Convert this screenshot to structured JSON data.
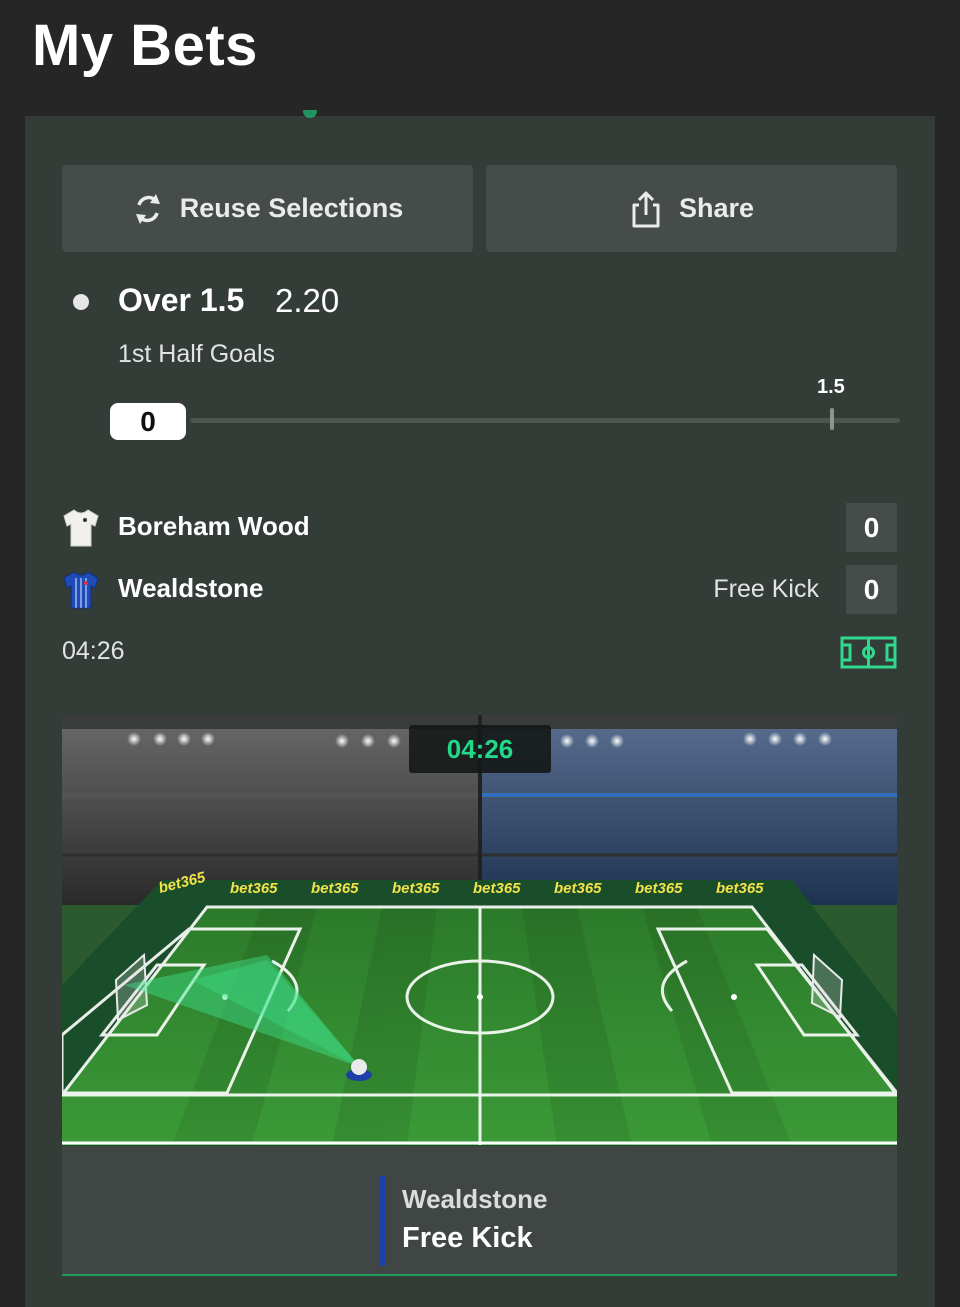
{
  "header": {
    "title": "My Bets"
  },
  "actions": {
    "reuse_label": "Reuse Selections",
    "share_label": "Share",
    "reuse_icon": "refresh-icon",
    "share_icon": "share-icon"
  },
  "selection": {
    "name": "Over 1.5",
    "odds": "2.20",
    "market": "1st Half Goals",
    "progress_current": "0",
    "progress_target": "1.5"
  },
  "match": {
    "teams": [
      {
        "name": "Boreham Wood",
        "score": "0",
        "status": "",
        "shirt_color": "#f2f0ea"
      },
      {
        "name": "Wealdstone",
        "score": "0",
        "status": "Free Kick",
        "shirt_color": "#1f4bb8"
      }
    ],
    "clock": "04:26",
    "view_icon": "pitch-icon"
  },
  "visualization": {
    "clock": "04:26",
    "sponsor": "bet365",
    "event_team": "Wealdstone",
    "event_type": "Free Kick",
    "accent": "#24d88a"
  }
}
